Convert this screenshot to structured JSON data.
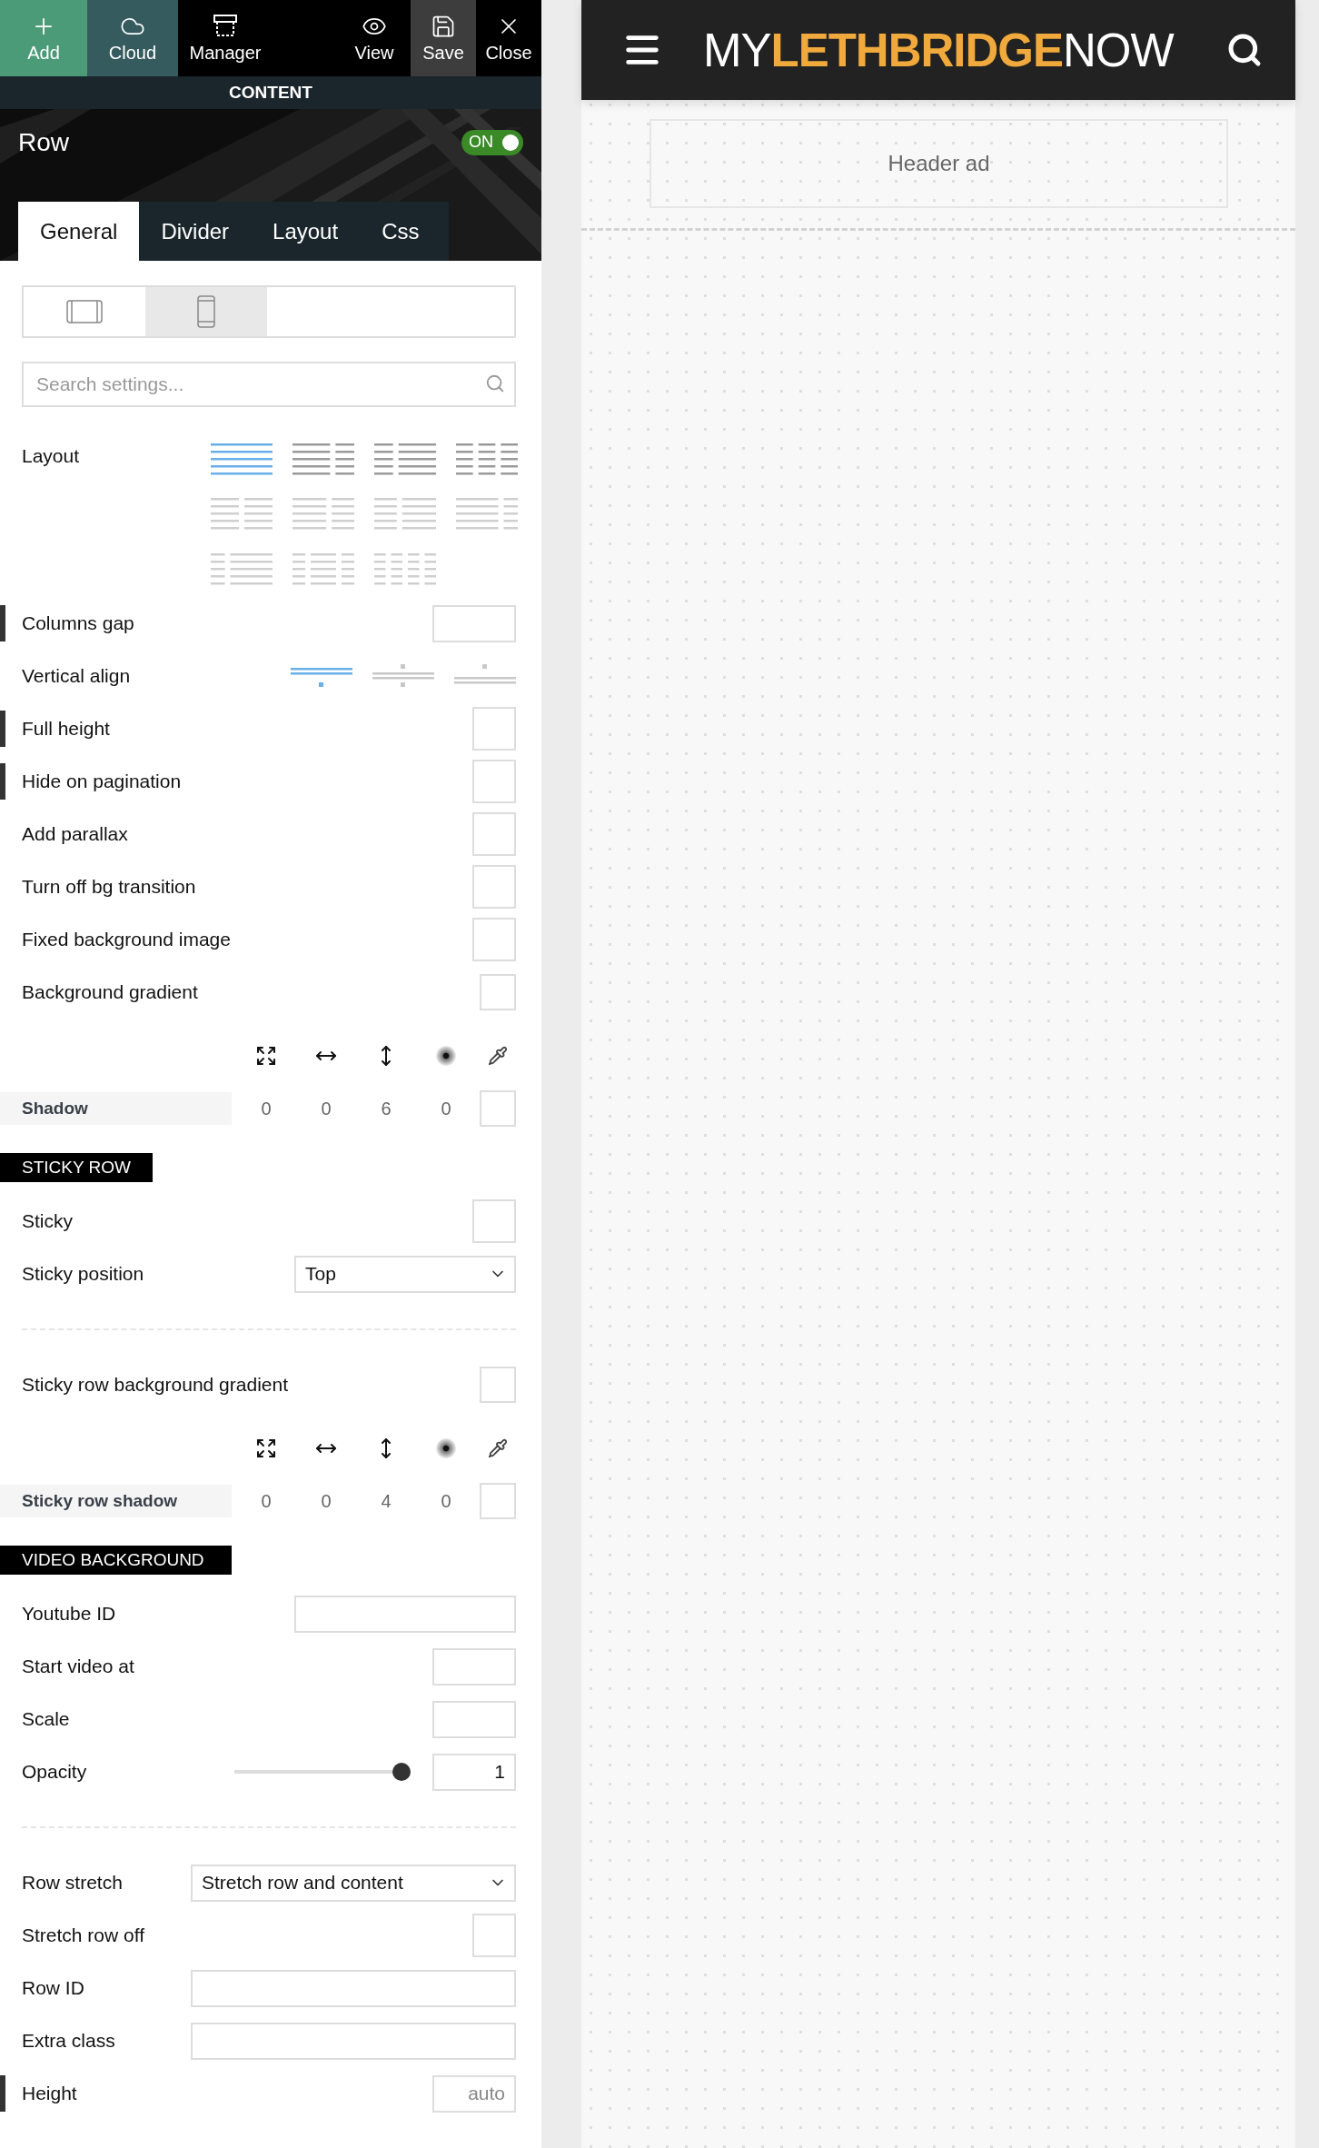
{
  "toolbar": [
    {
      "kind": "add",
      "label": "Add",
      "color": "#4b9b79"
    },
    {
      "kind": "cloud",
      "label": "Cloud",
      "color": "#365b5e"
    },
    {
      "kind": "manager",
      "label": "Manager",
      "color": "#000000"
    },
    {
      "kind": "view",
      "label": "View",
      "color": "#000000"
    },
    {
      "kind": "save",
      "label": "Save",
      "color": "#3d3d3d"
    },
    {
      "kind": "close",
      "label": "Close",
      "color": "#000000"
    }
  ],
  "section_bar": "CONTENT",
  "element": {
    "title": "Row",
    "toggle": {
      "label": "ON",
      "on": true
    }
  },
  "tabs": [
    {
      "label": "General",
      "selected": true
    },
    {
      "label": "Divider",
      "selected": false
    },
    {
      "label": "Layout",
      "selected": false
    },
    {
      "label": "Css",
      "selected": false
    }
  ],
  "devices": [
    {
      "kind": "tablet",
      "selected": false
    },
    {
      "kind": "phone",
      "selected": true
    }
  ],
  "search": {
    "placeholder": "Search settings..."
  },
  "settings": [
    {
      "kind": "layout",
      "label": "Layout",
      "marked": false,
      "options": [
        {
          "selected": true
        },
        {
          "selected": false
        },
        {
          "selected": false
        },
        {
          "selected": false
        },
        {
          "selected": false
        },
        {
          "selected": false
        },
        {
          "selected": false
        },
        {
          "selected": false
        },
        {
          "selected": false
        },
        {
          "selected": false
        },
        {
          "selected": false
        }
      ]
    },
    {
      "kind": "shortinput",
      "label": "Columns gap",
      "marked": true
    },
    {
      "kind": "align",
      "label": "Vertical align",
      "marked": false,
      "options": [
        {
          "selected": true
        },
        {
          "selected": false
        },
        {
          "selected": false
        }
      ]
    },
    {
      "kind": "checkbox",
      "label": "Full height",
      "marked": true,
      "checked": false
    },
    {
      "kind": "checkbox",
      "label": "Hide on pagination",
      "marked": true,
      "checked": false
    },
    {
      "kind": "checkbox",
      "label": "Add parallax",
      "marked": false,
      "checked": false
    },
    {
      "kind": "checkbox",
      "label": "Turn off bg transition",
      "marked": false,
      "checked": false
    },
    {
      "kind": "checkbox",
      "label": "Fixed background image",
      "marked": false,
      "checked": false
    },
    {
      "kind": "gradient",
      "label": "Background gradient",
      "marked": false
    },
    {
      "kind": "shadow",
      "label": "Shadow",
      "values": [
        "0",
        "0",
        "6",
        "0"
      ]
    },
    {
      "kind": "heading",
      "label": "STICKY ROW"
    },
    {
      "kind": "checkbox",
      "label": "Sticky",
      "marked": false,
      "checked": false
    },
    {
      "kind": "select",
      "label": "Sticky position",
      "marked": false,
      "value": "Top"
    },
    {
      "kind": "divider"
    },
    {
      "kind": "gradient",
      "label": "Sticky row background gradient",
      "marked": false
    },
    {
      "kind": "shadow",
      "label": "Sticky row shadow",
      "values": [
        "0",
        "0",
        "4",
        "0"
      ]
    },
    {
      "kind": "heading",
      "label": "VIDEO BACKGROUND"
    },
    {
      "kind": "input",
      "label": "Youtube ID",
      "marked": false
    },
    {
      "kind": "shortinput",
      "label": "Start video at",
      "marked": false
    },
    {
      "kind": "shortinput",
      "label": "Scale",
      "marked": false
    },
    {
      "kind": "slider",
      "label": "Opacity",
      "marked": false,
      "level": 1,
      "value": "1"
    },
    {
      "kind": "divider"
    },
    {
      "kind": "wideselect",
      "label": "Row stretch",
      "marked": false,
      "value": "Stretch row and content"
    },
    {
      "kind": "checkbox",
      "label": "Stretch row off",
      "marked": false,
      "checked": false
    },
    {
      "kind": "wideinput",
      "label": "Row ID",
      "marked": false
    },
    {
      "kind": "wideinput",
      "label": "Extra class",
      "marked": false
    },
    {
      "kind": "shortinput",
      "label": "Height",
      "marked": true,
      "placeholder": "auto"
    }
  ],
  "site": {
    "logo": [
      {
        "text": "MY",
        "highlight": false
      },
      {
        "text": "LETHBRIDGE",
        "highlight": true
      },
      {
        "text": "NOW",
        "highlight": false
      }
    ],
    "ad_slot": "Header ad"
  }
}
